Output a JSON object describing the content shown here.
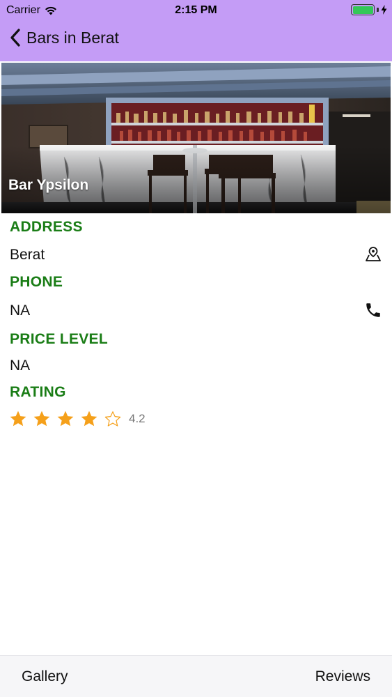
{
  "status_bar": {
    "carrier": "Carrier",
    "time": "2:15 PM",
    "battery_level": 1.0
  },
  "nav": {
    "back_title": "Bars in Berat"
  },
  "hero": {
    "title": "Bar Ypsilon"
  },
  "details": {
    "address_label": "ADDRESS",
    "address_value": "Berat",
    "phone_label": "PHONE",
    "phone_value": "NA",
    "price_label": "PRICE LEVEL",
    "price_value": "NA",
    "rating_label": "RATING",
    "rating_value": "4.2",
    "rating_stars_filled": 4,
    "rating_stars_total": 5
  },
  "bottom_bar": {
    "gallery_label": "Gallery",
    "reviews_label": "Reviews"
  },
  "colors": {
    "header_bg": "#c49cf6",
    "label_green": "#1a7d16",
    "star_orange": "#f5a01a"
  },
  "icons": {
    "address_action": "map-pin-icon",
    "phone_action": "phone-icon",
    "back": "chevron-left-icon"
  }
}
